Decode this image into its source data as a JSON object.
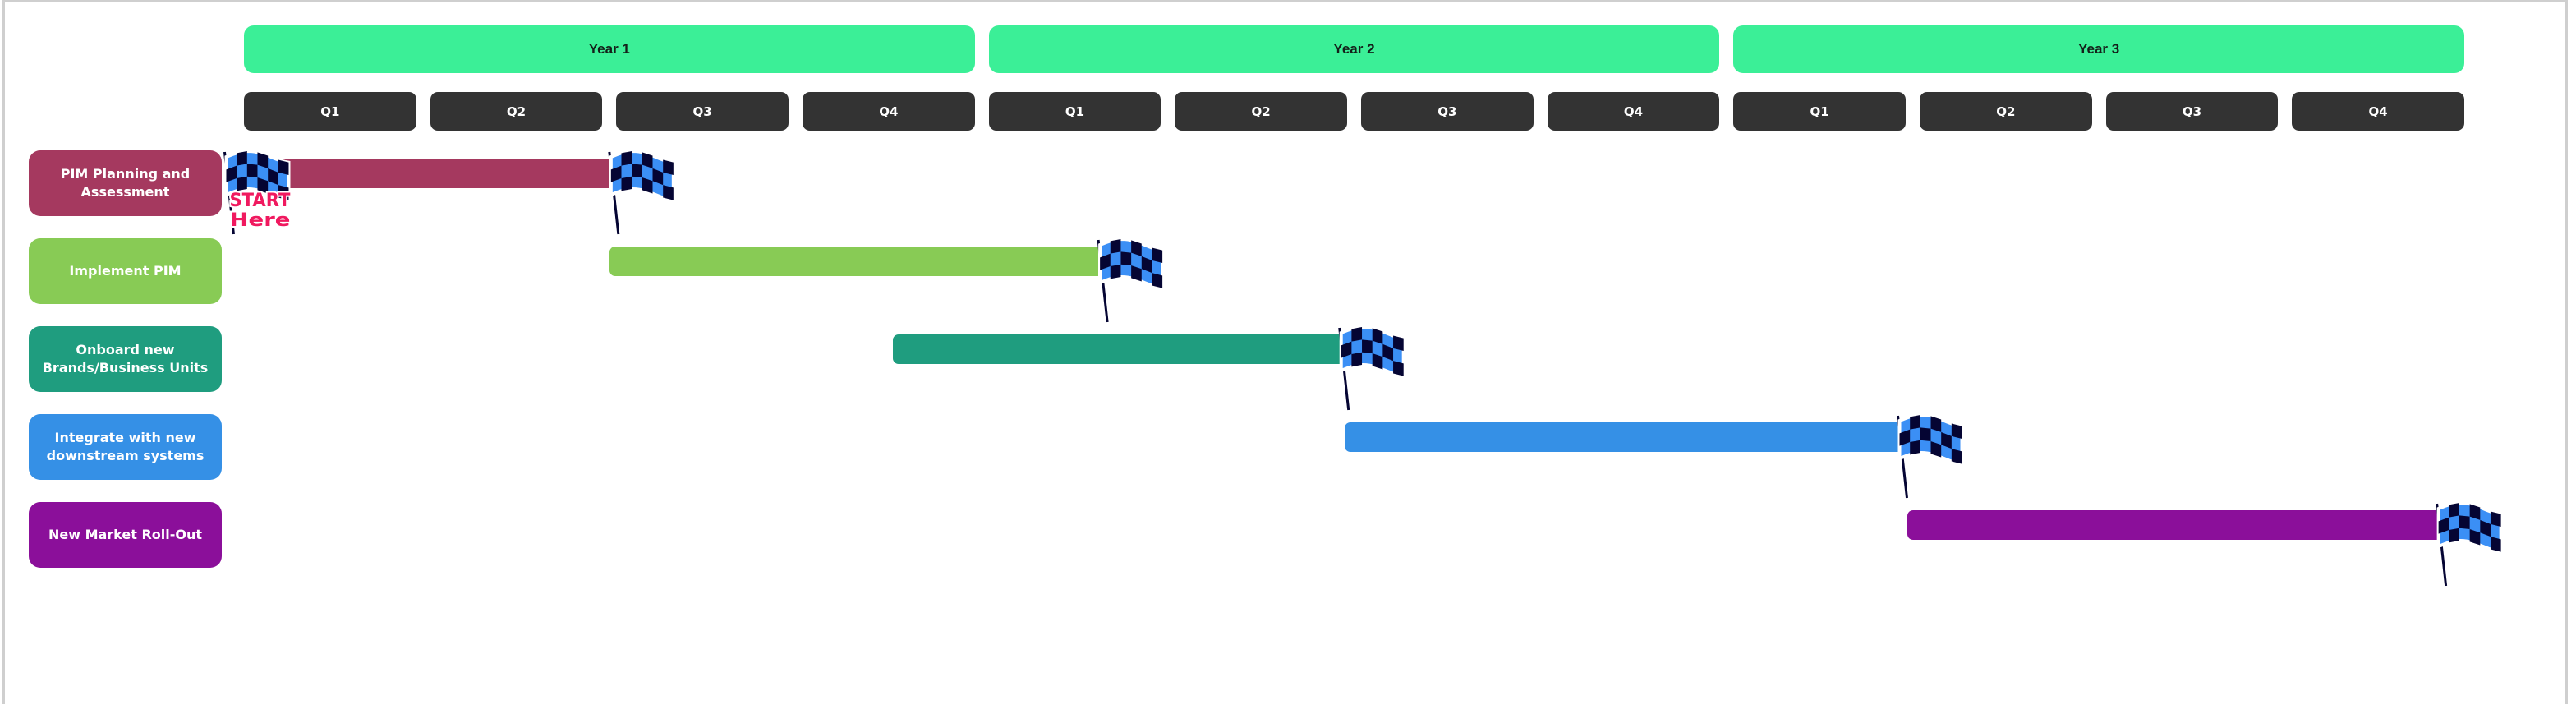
{
  "chart_data": {
    "type": "gantt",
    "title": "",
    "years": [
      "Year 1",
      "Year 2",
      "Year 3"
    ],
    "quarters": [
      "Q1",
      "Q2",
      "Q3",
      "Q4",
      "Q1",
      "Q2",
      "Q3",
      "Q4",
      "Q1",
      "Q2",
      "Q3",
      "Q4"
    ],
    "x_unit": "quarters from start",
    "x_range": [
      0,
      12
    ],
    "tasks": [
      {
        "label": "PIM Planning and Assessment",
        "start": 0.2,
        "end": 2.0,
        "color": "#a5395f",
        "start_marker": "START HERE",
        "end_marker": "checkered-flag"
      },
      {
        "label": "Implement PIM",
        "start": 2.0,
        "end": 4.6,
        "color": "#88cb55",
        "end_marker": "checkered-flag"
      },
      {
        "label": "Onboard new Brands/Business Units",
        "start": 3.55,
        "end": 5.92,
        "color": "#1f9d7f",
        "end_marker": "checkered-flag"
      },
      {
        "label": "Integrate with new downstream systems",
        "start": 5.95,
        "end": 8.9,
        "color": "#3590e6",
        "end_marker": "checkered-flag"
      },
      {
        "label": "New Market Roll-Out",
        "start": 8.95,
        "end": 11.85,
        "color": "#8b0f9a",
        "end_marker": "checkered-flag"
      }
    ]
  },
  "colors": {
    "year_header": "#3bef97",
    "quarter_header": "#333333",
    "flag_light": "#3b8ff5",
    "flag_dark": "#050533",
    "start_text": "#f0195f"
  },
  "start_label": {
    "line1": "START",
    "line2": "Here"
  }
}
